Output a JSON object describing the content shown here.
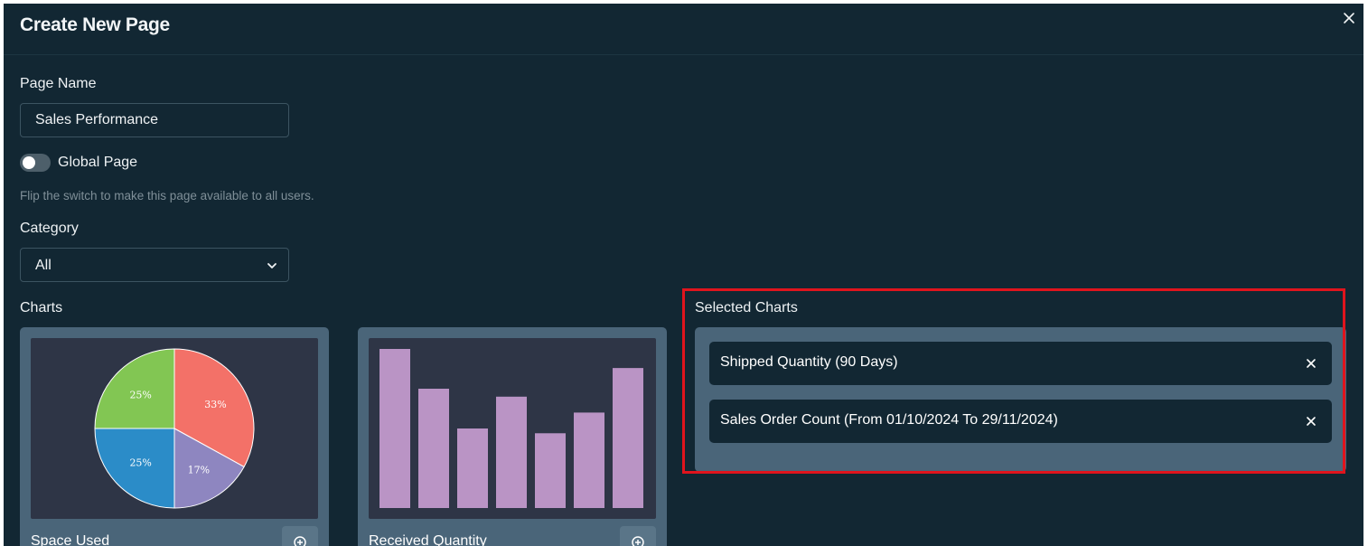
{
  "dialog": {
    "title": "Create New Page"
  },
  "form": {
    "page_name_label": "Page Name",
    "page_name_value": "Sales Performance",
    "global_toggle_label": "Global Page",
    "global_toggle_on": false,
    "global_help_text": "Flip the switch to make this page available to all users.",
    "category_label": "Category",
    "category_value": "All",
    "charts_label": "Charts",
    "selected_charts_label": "Selected Charts"
  },
  "charts": [
    {
      "title": "Space Used",
      "preview": {
        "type": "pie",
        "slices": [
          {
            "label": "33%",
            "value": 33,
            "color": "#f37168"
          },
          {
            "label": "17%",
            "value": 17,
            "color": "#8e86c0"
          },
          {
            "label": "25%",
            "value": 25,
            "color": "#2b8cc8"
          },
          {
            "label": "25%",
            "value": 25,
            "color": "#82c653"
          }
        ]
      }
    },
    {
      "title": "Received Quantity",
      "preview": {
        "type": "bar",
        "values": [
          100,
          75,
          50,
          70,
          47,
          60,
          88
        ],
        "color": "#ba94c5"
      }
    }
  ],
  "selected_charts": [
    {
      "label": "Shipped Quantity (90 Days)"
    },
    {
      "label": "Sales Order Count (From 01/10/2024 To 29/11/2024)"
    }
  ],
  "colors": {
    "modal_bg": "#122733",
    "card_bg": "#4a6579",
    "highlight": "#e0141d"
  }
}
